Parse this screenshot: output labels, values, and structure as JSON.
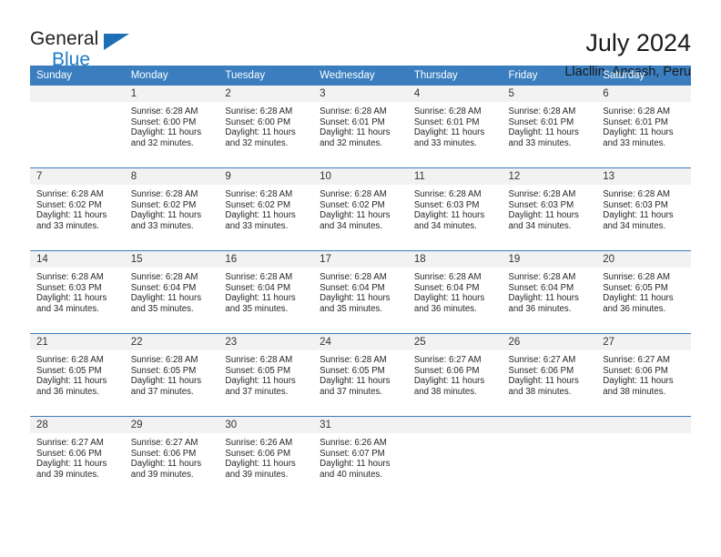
{
  "logo": {
    "word_top": "General",
    "word_bottom": "Blue",
    "triangle_color": "#1e6fb5",
    "blue_color": "#1e7bc4"
  },
  "header": {
    "title": "July 2024",
    "subtitle": "Llacllin, Ancash, Peru"
  },
  "theme": {
    "header_blue": "#3a7ebf",
    "date_band_gray": "#f2f2f2",
    "text": "#262626"
  },
  "weekday_headers": [
    "Sunday",
    "Monday",
    "Tuesday",
    "Wednesday",
    "Thursday",
    "Friday",
    "Saturday"
  ],
  "weeks": [
    [
      {
        "date": "",
        "sunrise": "",
        "sunset": "",
        "daylight_1": "",
        "daylight_2": "",
        "empty": true
      },
      {
        "date": "1",
        "sunrise": "Sunrise: 6:28 AM",
        "sunset": "Sunset: 6:00 PM",
        "daylight_1": "Daylight: 11 hours",
        "daylight_2": "and 32 minutes."
      },
      {
        "date": "2",
        "sunrise": "Sunrise: 6:28 AM",
        "sunset": "Sunset: 6:00 PM",
        "daylight_1": "Daylight: 11 hours",
        "daylight_2": "and 32 minutes."
      },
      {
        "date": "3",
        "sunrise": "Sunrise: 6:28 AM",
        "sunset": "Sunset: 6:01 PM",
        "daylight_1": "Daylight: 11 hours",
        "daylight_2": "and 32 minutes."
      },
      {
        "date": "4",
        "sunrise": "Sunrise: 6:28 AM",
        "sunset": "Sunset: 6:01 PM",
        "daylight_1": "Daylight: 11 hours",
        "daylight_2": "and 33 minutes."
      },
      {
        "date": "5",
        "sunrise": "Sunrise: 6:28 AM",
        "sunset": "Sunset: 6:01 PM",
        "daylight_1": "Daylight: 11 hours",
        "daylight_2": "and 33 minutes."
      },
      {
        "date": "6",
        "sunrise": "Sunrise: 6:28 AM",
        "sunset": "Sunset: 6:01 PM",
        "daylight_1": "Daylight: 11 hours",
        "daylight_2": "and 33 minutes."
      }
    ],
    [
      {
        "date": "7",
        "sunrise": "Sunrise: 6:28 AM",
        "sunset": "Sunset: 6:02 PM",
        "daylight_1": "Daylight: 11 hours",
        "daylight_2": "and 33 minutes."
      },
      {
        "date": "8",
        "sunrise": "Sunrise: 6:28 AM",
        "sunset": "Sunset: 6:02 PM",
        "daylight_1": "Daylight: 11 hours",
        "daylight_2": "and 33 minutes."
      },
      {
        "date": "9",
        "sunrise": "Sunrise: 6:28 AM",
        "sunset": "Sunset: 6:02 PM",
        "daylight_1": "Daylight: 11 hours",
        "daylight_2": "and 33 minutes."
      },
      {
        "date": "10",
        "sunrise": "Sunrise: 6:28 AM",
        "sunset": "Sunset: 6:02 PM",
        "daylight_1": "Daylight: 11 hours",
        "daylight_2": "and 34 minutes."
      },
      {
        "date": "11",
        "sunrise": "Sunrise: 6:28 AM",
        "sunset": "Sunset: 6:03 PM",
        "daylight_1": "Daylight: 11 hours",
        "daylight_2": "and 34 minutes."
      },
      {
        "date": "12",
        "sunrise": "Sunrise: 6:28 AM",
        "sunset": "Sunset: 6:03 PM",
        "daylight_1": "Daylight: 11 hours",
        "daylight_2": "and 34 minutes."
      },
      {
        "date": "13",
        "sunrise": "Sunrise: 6:28 AM",
        "sunset": "Sunset: 6:03 PM",
        "daylight_1": "Daylight: 11 hours",
        "daylight_2": "and 34 minutes."
      }
    ],
    [
      {
        "date": "14",
        "sunrise": "Sunrise: 6:28 AM",
        "sunset": "Sunset: 6:03 PM",
        "daylight_1": "Daylight: 11 hours",
        "daylight_2": "and 34 minutes."
      },
      {
        "date": "15",
        "sunrise": "Sunrise: 6:28 AM",
        "sunset": "Sunset: 6:04 PM",
        "daylight_1": "Daylight: 11 hours",
        "daylight_2": "and 35 minutes."
      },
      {
        "date": "16",
        "sunrise": "Sunrise: 6:28 AM",
        "sunset": "Sunset: 6:04 PM",
        "daylight_1": "Daylight: 11 hours",
        "daylight_2": "and 35 minutes."
      },
      {
        "date": "17",
        "sunrise": "Sunrise: 6:28 AM",
        "sunset": "Sunset: 6:04 PM",
        "daylight_1": "Daylight: 11 hours",
        "daylight_2": "and 35 minutes."
      },
      {
        "date": "18",
        "sunrise": "Sunrise: 6:28 AM",
        "sunset": "Sunset: 6:04 PM",
        "daylight_1": "Daylight: 11 hours",
        "daylight_2": "and 36 minutes."
      },
      {
        "date": "19",
        "sunrise": "Sunrise: 6:28 AM",
        "sunset": "Sunset: 6:04 PM",
        "daylight_1": "Daylight: 11 hours",
        "daylight_2": "and 36 minutes."
      },
      {
        "date": "20",
        "sunrise": "Sunrise: 6:28 AM",
        "sunset": "Sunset: 6:05 PM",
        "daylight_1": "Daylight: 11 hours",
        "daylight_2": "and 36 minutes."
      }
    ],
    [
      {
        "date": "21",
        "sunrise": "Sunrise: 6:28 AM",
        "sunset": "Sunset: 6:05 PM",
        "daylight_1": "Daylight: 11 hours",
        "daylight_2": "and 36 minutes."
      },
      {
        "date": "22",
        "sunrise": "Sunrise: 6:28 AM",
        "sunset": "Sunset: 6:05 PM",
        "daylight_1": "Daylight: 11 hours",
        "daylight_2": "and 37 minutes."
      },
      {
        "date": "23",
        "sunrise": "Sunrise: 6:28 AM",
        "sunset": "Sunset: 6:05 PM",
        "daylight_1": "Daylight: 11 hours",
        "daylight_2": "and 37 minutes."
      },
      {
        "date": "24",
        "sunrise": "Sunrise: 6:28 AM",
        "sunset": "Sunset: 6:05 PM",
        "daylight_1": "Daylight: 11 hours",
        "daylight_2": "and 37 minutes."
      },
      {
        "date": "25",
        "sunrise": "Sunrise: 6:27 AM",
        "sunset": "Sunset: 6:06 PM",
        "daylight_1": "Daylight: 11 hours",
        "daylight_2": "and 38 minutes."
      },
      {
        "date": "26",
        "sunrise": "Sunrise: 6:27 AM",
        "sunset": "Sunset: 6:06 PM",
        "daylight_1": "Daylight: 11 hours",
        "daylight_2": "and 38 minutes."
      },
      {
        "date": "27",
        "sunrise": "Sunrise: 6:27 AM",
        "sunset": "Sunset: 6:06 PM",
        "daylight_1": "Daylight: 11 hours",
        "daylight_2": "and 38 minutes."
      }
    ],
    [
      {
        "date": "28",
        "sunrise": "Sunrise: 6:27 AM",
        "sunset": "Sunset: 6:06 PM",
        "daylight_1": "Daylight: 11 hours",
        "daylight_2": "and 39 minutes."
      },
      {
        "date": "29",
        "sunrise": "Sunrise: 6:27 AM",
        "sunset": "Sunset: 6:06 PM",
        "daylight_1": "Daylight: 11 hours",
        "daylight_2": "and 39 minutes."
      },
      {
        "date": "30",
        "sunrise": "Sunrise: 6:26 AM",
        "sunset": "Sunset: 6:06 PM",
        "daylight_1": "Daylight: 11 hours",
        "daylight_2": "and 39 minutes."
      },
      {
        "date": "31",
        "sunrise": "Sunrise: 6:26 AM",
        "sunset": "Sunset: 6:07 PM",
        "daylight_1": "Daylight: 11 hours",
        "daylight_2": "and 40 minutes."
      },
      {
        "date": "",
        "sunrise": "",
        "sunset": "",
        "daylight_1": "",
        "daylight_2": "",
        "empty": true
      },
      {
        "date": "",
        "sunrise": "",
        "sunset": "",
        "daylight_1": "",
        "daylight_2": "",
        "empty": true
      },
      {
        "date": "",
        "sunrise": "",
        "sunset": "",
        "daylight_1": "",
        "daylight_2": "",
        "empty": true
      }
    ]
  ]
}
